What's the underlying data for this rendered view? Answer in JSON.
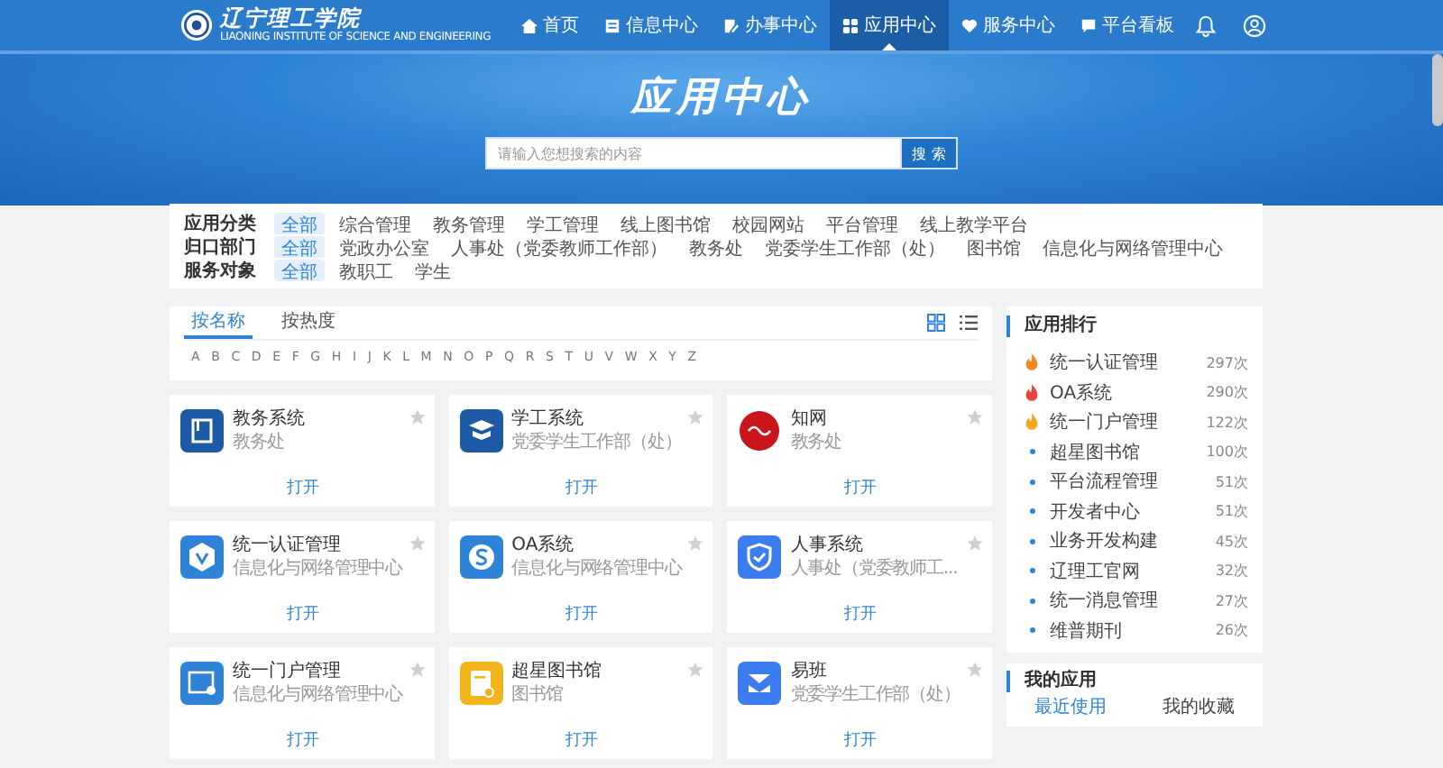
{
  "logo": {
    "name": "辽宁理工学院",
    "subtitle": "LIAONING INSTITUTE OF SCIENCE AND ENGINEERING"
  },
  "nav": [
    {
      "label": "首页",
      "selected": false
    },
    {
      "label": "信息中心",
      "selected": false
    },
    {
      "label": "办事中心",
      "selected": false
    },
    {
      "label": "应用中心",
      "selected": true
    },
    {
      "label": "服务中心",
      "selected": false
    },
    {
      "label": "平台看板",
      "selected": false
    }
  ],
  "hero": {
    "title": "应用中心",
    "search": {
      "placeholder": "请输入您想搜索的内容",
      "button": "搜 索"
    }
  },
  "filters": [
    {
      "label": "应用分类",
      "options": [
        {
          "label": "全部",
          "selected": true
        },
        {
          "label": "综合管理",
          "selected": false
        },
        {
          "label": "教务管理",
          "selected": false
        },
        {
          "label": "学工管理",
          "selected": false
        },
        {
          "label": "线上图书馆",
          "selected": false
        },
        {
          "label": "校园网站",
          "selected": false
        },
        {
          "label": "平台管理",
          "selected": false
        },
        {
          "label": "线上教学平台",
          "selected": false
        }
      ]
    },
    {
      "label": "归口部门",
      "options": [
        {
          "label": "全部",
          "selected": true
        },
        {
          "label": "党政办公室",
          "selected": false
        },
        {
          "label": "人事处（党委教师工作部）",
          "selected": false
        },
        {
          "label": "教务处",
          "selected": false
        },
        {
          "label": "党委学生工作部（处）",
          "selected": false
        },
        {
          "label": "图书馆",
          "selected": false
        },
        {
          "label": "信息化与网络管理中心",
          "selected": false
        }
      ]
    },
    {
      "label": "服务对象",
      "options": [
        {
          "label": "全部",
          "selected": true
        },
        {
          "label": "教职工",
          "selected": false
        },
        {
          "label": "学生",
          "selected": false
        }
      ]
    }
  ],
  "sort_tabs": [
    {
      "label": "按名称",
      "selected": true
    },
    {
      "label": "按热度",
      "selected": false
    }
  ],
  "view_modes": [
    {
      "kind": "grid",
      "selected": true
    },
    {
      "kind": "list",
      "selected": false
    }
  ],
  "letters": [
    "A",
    "B",
    "C",
    "D",
    "E",
    "F",
    "G",
    "H",
    "I",
    "J",
    "K",
    "L",
    "M",
    "N",
    "O",
    "P",
    "Q",
    "R",
    "S",
    "T",
    "U",
    "V",
    "W",
    "X",
    "Y",
    "Z"
  ],
  "apps": [
    {
      "name": "教务系统",
      "department": "教务处",
      "action": "打开"
    },
    {
      "name": "学工系统",
      "department": "党委学生工作部（处）",
      "action": "打开"
    },
    {
      "name": "知网",
      "department": "教务处",
      "action": "打开"
    },
    {
      "name": "统一认证管理",
      "department": "信息化与网络管理中心",
      "action": "打开"
    },
    {
      "name": "OA系统",
      "department": "信息化与网络管理中心",
      "action": "打开"
    },
    {
      "name": "人事系统",
      "department": "人事处（党委教师工...",
      "action": "打开"
    },
    {
      "name": "统一门户管理",
      "department": "信息化与网络管理中心",
      "action": "打开"
    },
    {
      "name": "超星图书馆",
      "department": "图书馆",
      "action": "打开"
    },
    {
      "name": "易班",
      "department": "党委学生工作部（处）",
      "action": "打开"
    }
  ],
  "ranking": {
    "title": "应用排行",
    "items": [
      {
        "kind": "hot",
        "color": "#f08a24",
        "name": "统一认证管理",
        "count": "297次"
      },
      {
        "kind": "hot",
        "color": "#e8423a",
        "name": "OA系统",
        "count": "290次"
      },
      {
        "kind": "hot",
        "color": "#f5a623",
        "name": "统一门户管理",
        "count": "122次"
      },
      {
        "kind": "normal",
        "name": "超星图书馆",
        "count": "100次"
      },
      {
        "kind": "normal",
        "name": "平台流程管理",
        "count": "51次"
      },
      {
        "kind": "normal",
        "name": "开发者中心",
        "count": "51次"
      },
      {
        "kind": "normal",
        "name": "业务开发构建",
        "count": "45次"
      },
      {
        "kind": "normal",
        "name": "辽理工官网",
        "count": "32次"
      },
      {
        "kind": "normal",
        "name": "统一消息管理",
        "count": "27次"
      },
      {
        "kind": "normal",
        "name": "维普期刊",
        "count": "26次"
      }
    ]
  },
  "my_apps": {
    "title": "我的应用",
    "tabs": [
      {
        "label": "最近使用",
        "selected": true
      },
      {
        "label": "我的收藏",
        "selected": false
      }
    ]
  }
}
